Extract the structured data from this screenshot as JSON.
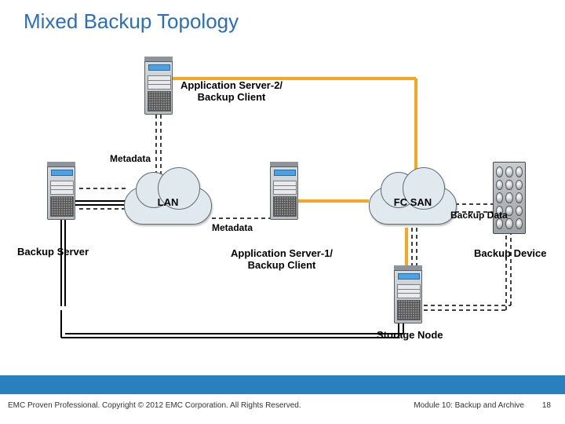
{
  "title": "Mixed Backup Topology",
  "labels": {
    "app_server_2": "Application Server-2/\nBackup Client",
    "app_server_1": "Application Server-1/\nBackup Client",
    "backup_server": "Backup Server",
    "backup_device": "Backup Device",
    "storage_node": "Storage Node",
    "metadata_top": "Metadata",
    "metadata_mid": "Metadata",
    "backup_data": "Backup Data",
    "lan": "LAN",
    "fcsan": "FC SAN"
  },
  "footer": {
    "left": "EMC Proven Professional. Copyright © 2012 EMC Corporation. All Rights Reserved.",
    "right": "Module 10: Backup and Archive",
    "slide_num": "18"
  },
  "colors": {
    "title": "#2a6ebf",
    "bar": "#2a7fbe",
    "san_line": "#f5a623"
  }
}
